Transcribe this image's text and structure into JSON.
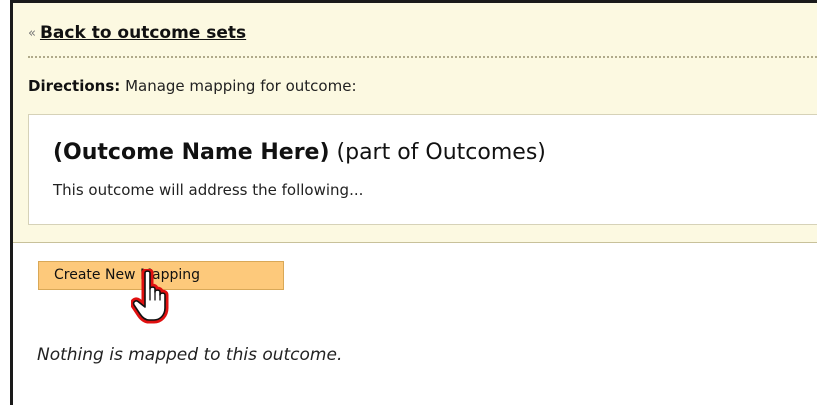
{
  "nav": {
    "back_marker": "«",
    "back_label": "Back to outcome sets"
  },
  "directions": {
    "label": "Directions:",
    "text": "Manage mapping for outcome:"
  },
  "outcome": {
    "name": "(Outcome Name Here)",
    "part_of": "(part of Outcomes)",
    "description": "This outcome will address the following..."
  },
  "actions": {
    "create_mapping_label": "Create New Mapping"
  },
  "mappings": {
    "empty_message": "Nothing is mapped to this outcome."
  },
  "colors": {
    "panel_background": "#fcf9e1",
    "button_background": "#fdc97b",
    "cursor_outline": "#e01010"
  },
  "icons": {
    "cursor": "hand-pointer-icon"
  }
}
